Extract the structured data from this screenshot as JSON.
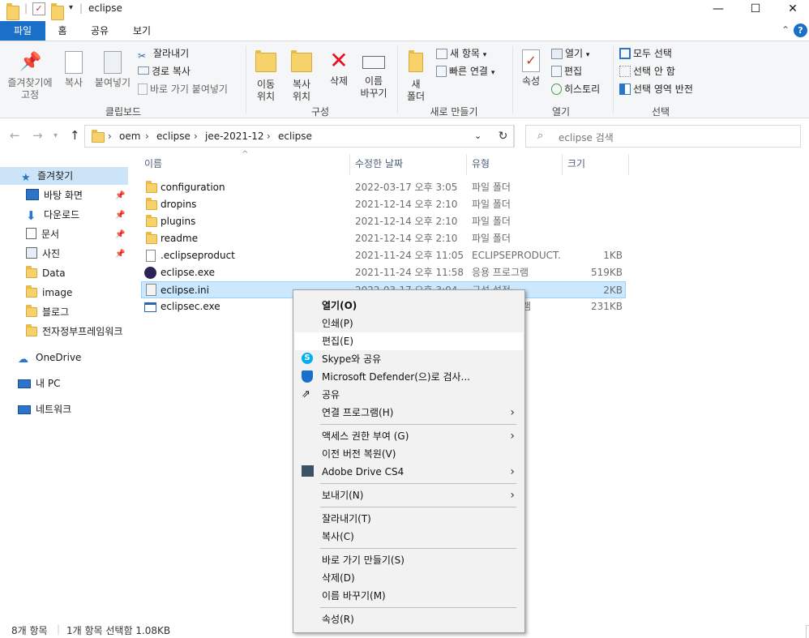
{
  "window": {
    "title": "eclipse",
    "minimize": "—",
    "maximize": "☐",
    "close": "✕"
  },
  "ribbon": {
    "tabs": [
      "파일",
      "홈",
      "공유",
      "보기"
    ],
    "clipboard": {
      "pin_quick": "즐겨찾기에\n고정",
      "copy": "복사",
      "paste": "붙여넣기",
      "cut": "잘라내기",
      "copy_path": "경로 복사",
      "paste_shortcut": "바로 가기 붙여넣기",
      "label": "클립보드"
    },
    "organize": {
      "move_to": "이동\n위치",
      "copy_to": "복사\n위치",
      "delete": "삭제",
      "rename": "이름\n바꾸기",
      "label": "구성"
    },
    "new": {
      "new_folder": "새\n폴더",
      "new_item": "새 항목",
      "easy_access": "빠른 연결",
      "label": "새로 만들기"
    },
    "open": {
      "properties": "속성",
      "open": "열기",
      "edit": "편집",
      "history": "히스토리",
      "label": "열기"
    },
    "select": {
      "select_all": "모두 선택",
      "select_none": "선택 안 함",
      "invert": "선택 영역 반전",
      "label": "선택"
    }
  },
  "address": {
    "crumbs": [
      "oem",
      "eclipse",
      "jee-2021-12",
      "eclipse"
    ],
    "search_placeholder": "eclipse 검색"
  },
  "navpane": {
    "quick_access": "즐겨찾기",
    "items": [
      {
        "label": "바탕 화면",
        "pinned": true
      },
      {
        "label": "다운로드",
        "pinned": true
      },
      {
        "label": "문서",
        "pinned": true
      },
      {
        "label": "사진",
        "pinned": true
      },
      {
        "label": "Data",
        "pinned": false
      },
      {
        "label": "image",
        "pinned": false
      },
      {
        "label": "블로그",
        "pinned": false
      },
      {
        "label": "전자정부프레임워크",
        "pinned": false
      }
    ],
    "onedrive": "OneDrive",
    "this_pc": "내 PC",
    "network": "네트워크"
  },
  "columns": {
    "name": "이름",
    "date": "수정한 날짜",
    "type": "유형",
    "size": "크기"
  },
  "files": [
    {
      "name": "configuration",
      "date": "2022-03-17 오후 3:05",
      "type": "파일 폴더",
      "size": "",
      "icon": "folder"
    },
    {
      "name": "dropins",
      "date": "2021-12-14 오후 2:10",
      "type": "파일 폴더",
      "size": "",
      "icon": "folder"
    },
    {
      "name": "plugins",
      "date": "2021-12-14 오후 2:10",
      "type": "파일 폴더",
      "size": "",
      "icon": "folder"
    },
    {
      "name": "readme",
      "date": "2021-12-14 오후 2:10",
      "type": "파일 폴더",
      "size": "",
      "icon": "folder"
    },
    {
      "name": ".eclipseproduct",
      "date": "2021-11-24 오후 11:05",
      "type": "ECLIPSEPRODUCT...",
      "size": "1KB",
      "icon": "file"
    },
    {
      "name": "eclipse.exe",
      "date": "2021-11-24 오후 11:58",
      "type": "응용 프로그램",
      "size": "519KB",
      "icon": "eclipse"
    },
    {
      "name": "eclipse.ini",
      "date": "2022-03-17 오후 3:04",
      "type": "구성 설정",
      "size": "2KB",
      "icon": "ini"
    },
    {
      "name": "eclipsec.exe",
      "date": "",
      "type": "램",
      "size": "231KB",
      "icon": "exe"
    }
  ],
  "status": {
    "count": "8개 항목",
    "selection": "1개 항목 선택함 1.08KB"
  },
  "context_menu": {
    "open": "열기(O)",
    "print": "인쇄(P)",
    "edit": "편집(E)",
    "skype": "Skype와 공유",
    "defender": "Microsoft Defender(으)로 검사...",
    "share": "공유",
    "open_with": "연결 프로그램(H)",
    "give_access": "액세스 권한 부여 (G)",
    "restore": "이전 버전 복원(V)",
    "adobe": "Adobe Drive CS4",
    "send_to": "보내기(N)",
    "cut": "잘라내기(T)",
    "copy": "복사(C)",
    "create_shortcut": "바로 가기 만들기(S)",
    "delete": "삭제(D)",
    "rename": "이름 바꾸기(M)",
    "properties": "속성(R)"
  }
}
